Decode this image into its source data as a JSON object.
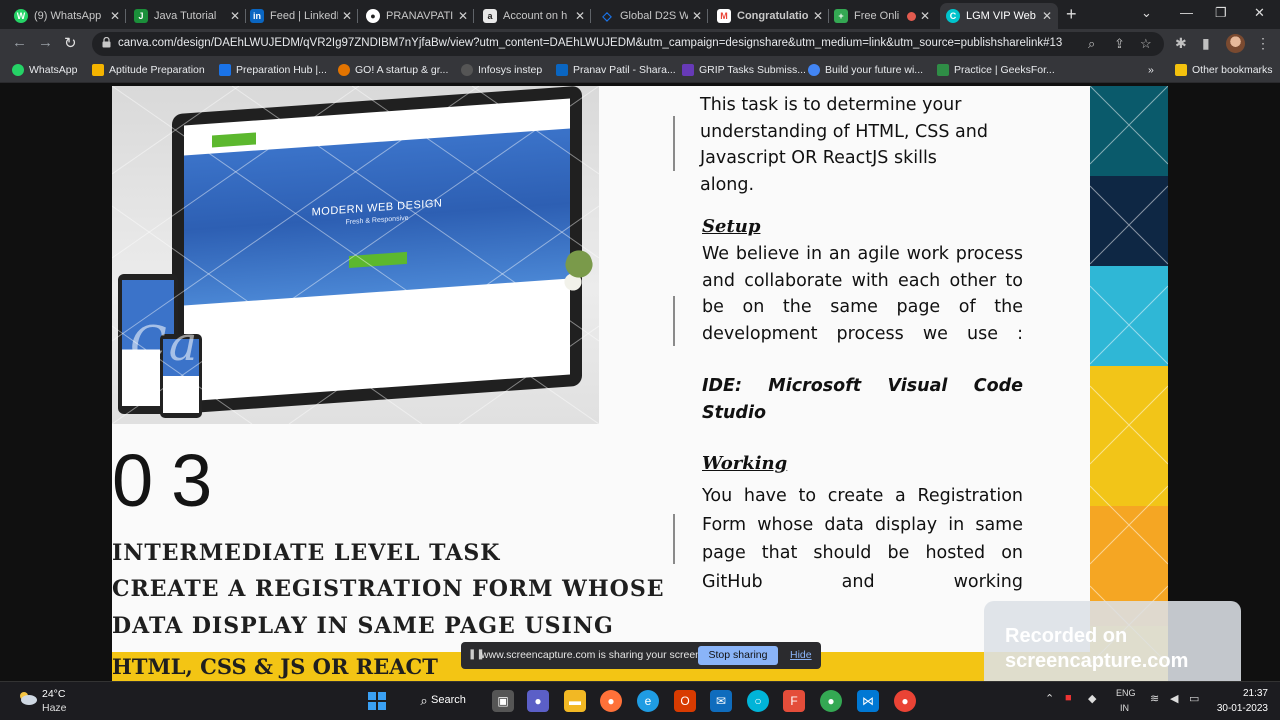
{
  "browser": {
    "tabs": [
      {
        "title": "(9) WhatsApp",
        "color": "#25d366",
        "glyph": "W"
      },
      {
        "title": "Java Tutorial",
        "color": "#1b8f3a",
        "glyph": "J"
      },
      {
        "title": "Feed | LinkedIn",
        "color": "#0a66c2",
        "glyph": "in"
      },
      {
        "title": "PRANAVPATIL",
        "color": "#444444",
        "glyph": "G"
      },
      {
        "title": "Account on h",
        "color": "#e8e8e8",
        "glyph": "a"
      },
      {
        "title": "Global D2S W",
        "color": "#1a73e8",
        "glyph": "◇"
      },
      {
        "title": "Congratulatio",
        "color": "#ea4335",
        "glyph": "M"
      },
      {
        "title": "Free Onli",
        "color": "#34a853",
        "glyph": "+"
      },
      {
        "title": "LGM VIP Web",
        "color": "#00c4cc",
        "glyph": "C"
      }
    ],
    "url": "canva.com/design/DAEhLWUJEDM/qVR2Ig97ZNDIBM7nYjfaBw/view?utm_content=DAEhLWUJEDM&utm_campaign=designshare&utm_medium=link&utm_source=publishsharelink#13",
    "bookmarks": [
      {
        "label": "WhatsApp",
        "color": "#25d366"
      },
      {
        "label": "Aptitude Preparation",
        "color": "#f4b400"
      },
      {
        "label": "Preparation Hub |...",
        "color": "#1a73e8"
      },
      {
        "label": "GO! A startup & gr...",
        "color": "#e37400"
      },
      {
        "label": "Infosys instep",
        "color": "#555555"
      },
      {
        "label": "Pranav Patil - Shara...",
        "color": "#0a66c2"
      },
      {
        "label": "GRIP Tasks Submiss...",
        "color": "#673ab7"
      },
      {
        "label": "Build your future wi...",
        "color": "#4285f4"
      },
      {
        "label": "Practice | GeeksFor...",
        "color": "#2f8d46"
      }
    ],
    "other_bookmarks": "Other bookmarks"
  },
  "slide": {
    "hero_title": "MODERN WEB DESIGN",
    "hero_sub": "Fresh & Responsive",
    "watermark": "Canva",
    "number": "03",
    "level_lines": [
      "INTERMEDIATE LEVEL TASK",
      "CREATE A REGISTRATION FORM WHOSE",
      "DATA DISPLAY IN SAME PAGE  USING"
    ],
    "yellow_line": "HTML, CSS & JS OR REACT",
    "intro": "This task is to determine your understanding  of HTML, CSS and Javascript OR ReactJS skills along.",
    "setup_heading": "Setup ",
    "setup_text": "We believe in an agile work process and collaborate with each other to be on the same page of the development process we use :",
    "setup_ide": "IDE: Microsoft Visual Code Studio",
    "working_heading": "Working ",
    "working_text": "You have to create a Registration Form whose data display in same page that should be hosted on GitHub and working"
  },
  "recorded": {
    "line1": "Recorded on",
    "line2": "screencapture.com"
  },
  "sharing": {
    "message": "www.screencapture.com is sharing your screen.",
    "stop": "Stop sharing",
    "hide": "Hide"
  },
  "taskbar": {
    "temperature": "24°C",
    "condition": "Haze",
    "search": "Search",
    "lang1": "ENG",
    "lang2": "IN",
    "time": "21:37",
    "date": "30-01-2023"
  }
}
